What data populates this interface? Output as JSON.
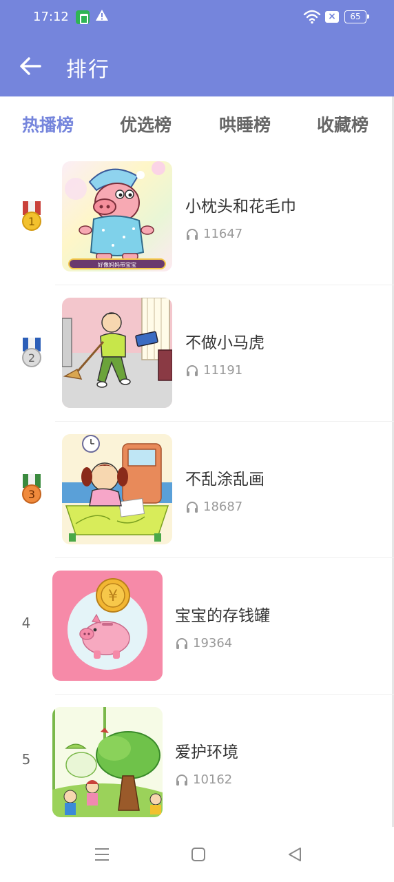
{
  "status_bar": {
    "time": "17:12",
    "battery": "65",
    "icons": [
      "app-notification-icon",
      "warning-icon",
      "wifi-icon",
      "sim-off-icon",
      "battery-icon"
    ]
  },
  "header": {
    "title": "排行",
    "back_icon": "arrow-left-icon",
    "background": "#7585dc"
  },
  "tabs": [
    {
      "label": "热播榜",
      "active": true
    },
    {
      "label": "优选榜",
      "active": false
    },
    {
      "label": "哄睡榜",
      "active": false
    },
    {
      "label": "收藏榜",
      "active": false
    }
  ],
  "accent_color": "#7585dc",
  "items": [
    {
      "rank": "1",
      "medal": "gold",
      "title": "小枕头和花毛巾",
      "plays": "11647"
    },
    {
      "rank": "2",
      "medal": "silver",
      "title": "不做小马虎",
      "plays": "11191"
    },
    {
      "rank": "3",
      "medal": "bronze",
      "title": "不乱涂乱画",
      "plays": "18687"
    },
    {
      "rank": "4",
      "medal": "",
      "title": "宝宝的存钱罐",
      "plays": "19364"
    },
    {
      "rank": "5",
      "medal": "",
      "title": "爱护环境",
      "plays": "10162"
    }
  ],
  "thumbnail_text": {
    "item1_banner": "好像妈妈带宝宝"
  },
  "nav_bar": {
    "icons": [
      "menu-icon",
      "home-square-icon",
      "back-triangle-icon"
    ]
  }
}
